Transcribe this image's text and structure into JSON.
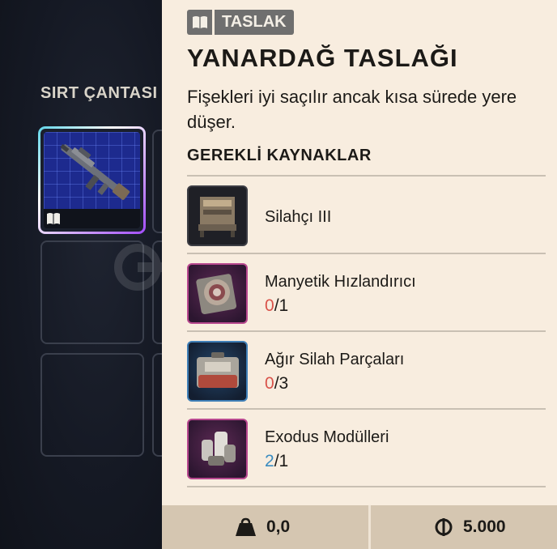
{
  "backpack": {
    "title": "SIRT ÇANTASI",
    "slots": [
      {
        "filled": true,
        "icon": "rifle-icon",
        "badge": "book-icon"
      },
      {
        "filled": false
      },
      {
        "filled": false
      }
    ]
  },
  "detail": {
    "tag_icon": "book-icon",
    "tag_label": "TASLAK",
    "title": "YANARDAĞ TASLAĞI",
    "description": "Fişekleri iyi saçılır ancak kısa sürede yere düşer.",
    "requirements_heading": "GEREKLİ KAYNAKLAR",
    "requirements": [
      {
        "name": "Silahçı III",
        "have": "",
        "need": "",
        "thumb_style": "dark",
        "icon": "workbench-icon"
      },
      {
        "name": "Manyetik Hızlandırıcı",
        "have": "0",
        "need": "/1",
        "thumb_style": "pink",
        "icon": "accelerator-icon",
        "have_color": "#d9534a"
      },
      {
        "name": "Ağır Silah Parçaları",
        "have": "0",
        "need": "/3",
        "thumb_style": "blue",
        "icon": "parts-case-icon",
        "have_color": "#d9534a"
      },
      {
        "name": "Exodus Modülleri",
        "have": "2",
        "need": "/1",
        "thumb_style": "pink",
        "icon": "modules-icon",
        "have_color": "#3b8cc0"
      }
    ]
  },
  "footer": {
    "weight_icon": "weight-icon",
    "weight": "0,0",
    "price_icon": "coin-icon",
    "price": "5.000"
  }
}
